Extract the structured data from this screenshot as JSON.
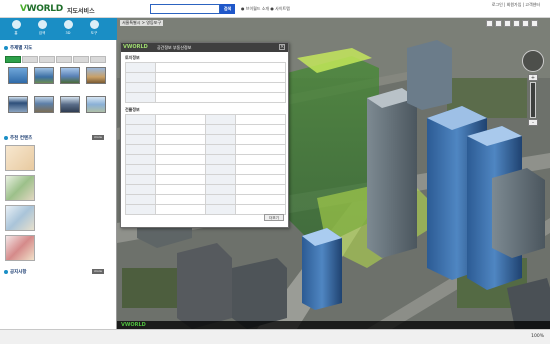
{
  "header": {
    "logo_v": "V",
    "logo_rest": "WORLD",
    "service_name": "지도서비스",
    "search_placeholder": "",
    "search_button": "검색",
    "links": "● 브이월드 소개  ● 사이트맵",
    "right_links": "로그인 | 회원가입 | 고객센터"
  },
  "sidebar": {
    "nav": [
      {
        "label": "홈"
      },
      {
        "label": "검색"
      },
      {
        "label": "3D"
      },
      {
        "label": "도구"
      }
    ],
    "section1_title": "주제별 지도",
    "tabs": [
      "",
      "",
      "",
      "",
      "",
      ""
    ],
    "thumbs": [
      {
        "label": ""
      },
      {
        "label": ""
      },
      {
        "label": ""
      },
      {
        "label": ""
      },
      {
        "label": ""
      },
      {
        "label": ""
      },
      {
        "label": ""
      },
      {
        "label": ""
      }
    ],
    "section2_title": "추천 컨텐츠",
    "more_label": "more",
    "cards": [
      {
        "title": "",
        "desc1": "",
        "desc2": ""
      },
      {
        "title": "",
        "desc1": "",
        "desc2": ""
      },
      {
        "title": "",
        "desc1": "",
        "desc2": ""
      },
      {
        "title": "",
        "desc1": "",
        "desc2": ""
      }
    ],
    "section3_title": "공지사항",
    "news": [
      {
        "title": "",
        "date": ""
      },
      {
        "title": "",
        "date": ""
      },
      {
        "title": "",
        "date": ""
      },
      {
        "title": "",
        "date": ""
      },
      {
        "title": "",
        "date": ""
      },
      {
        "title": "",
        "date": ""
      }
    ]
  },
  "map": {
    "breadcrumb": "서울특별시 > 영등포구",
    "footer_logo": "VWORLD",
    "footer_text": "",
    "footer_copy": "",
    "zoom_plus": "+",
    "zoom_minus": "-",
    "pois": [
      "",
      "",
      "",
      "",
      "",
      "",
      "",
      "",
      "",
      "",
      "",
      ""
    ]
  },
  "popup": {
    "logo": "VWORLD",
    "title": "공간정보 부동산정보",
    "close": "×",
    "section1": "토지정보",
    "section2": "건물정보",
    "rows1": [
      [
        "",
        "",
        "",
        ""
      ],
      [
        "",
        "",
        "",
        ""
      ],
      [
        "",
        "",
        "",
        ""
      ],
      [
        "",
        "",
        "",
        ""
      ]
    ],
    "rows2": [
      [
        "",
        "",
        "",
        ""
      ],
      [
        "",
        "",
        "",
        ""
      ],
      [
        "",
        "",
        "",
        ""
      ],
      [
        "",
        "",
        "",
        ""
      ],
      [
        "",
        "",
        "",
        ""
      ],
      [
        "",
        "",
        "",
        ""
      ],
      [
        "",
        "",
        "",
        ""
      ],
      [
        "",
        "",
        "",
        ""
      ],
      [
        "",
        "",
        "",
        ""
      ],
      [
        "",
        "",
        "",
        ""
      ]
    ],
    "more_button": "더보기"
  },
  "status": {
    "zoom_level": "100%"
  },
  "colors": {
    "nav_blue": "#1a8ec5",
    "search_blue": "#1f57c9",
    "tab_green": "#2da04a",
    "highlight_green": "#b8e04a"
  }
}
